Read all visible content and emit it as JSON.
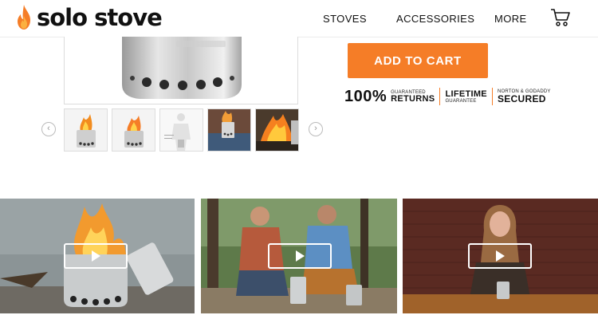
{
  "brand": {
    "name": "solo stove",
    "accent_color": "#f57d27"
  },
  "nav": {
    "items": [
      {
        "label": "STOVES"
      },
      {
        "label": "ACCESSORIES"
      },
      {
        "label": "MORE"
      }
    ],
    "cart_icon": "shopping-cart-icon"
  },
  "product": {
    "thumbnails_count": 5,
    "prev_icon": "chevron-left-icon",
    "next_icon": "chevron-right-icon"
  },
  "buy_box": {
    "add_to_cart": "ADD TO CART",
    "badges": {
      "percent": "100%",
      "guaranteed": "GUARANTEED",
      "returns": "RETURNS",
      "lifetime": "LIFETIME",
      "guarantee": "GUARANTEE",
      "norton": "NORTON & GODADDY",
      "secured": "SECURED"
    }
  },
  "videos": {
    "count": 3,
    "play_icon": "play-icon"
  }
}
